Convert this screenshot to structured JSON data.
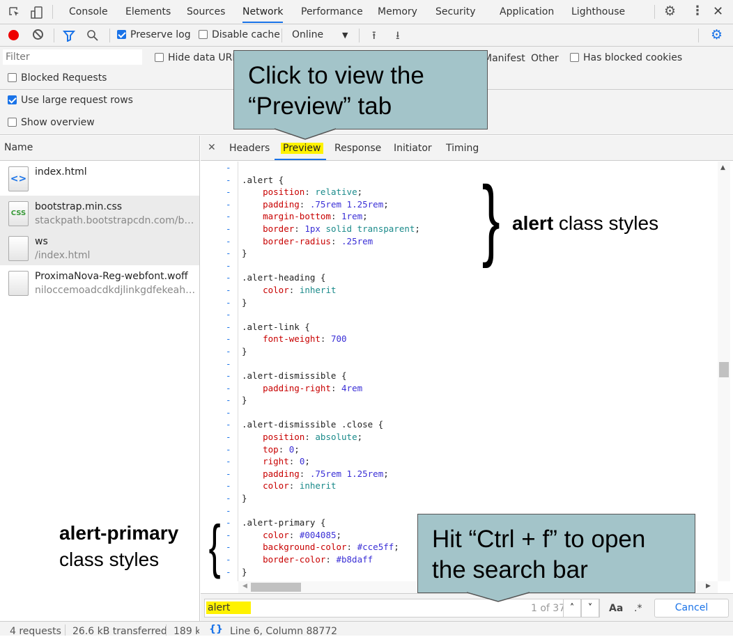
{
  "tabs": [
    "Console",
    "Elements",
    "Sources",
    "Network",
    "Performance",
    "Memory",
    "Security",
    "Application",
    "Lighthouse"
  ],
  "active_tab": "Network",
  "toolbar": {
    "preserve_log": "Preserve log",
    "disable_cache": "Disable cache",
    "throttle": "Online"
  },
  "filter": {
    "placeholder": "Filter",
    "hide_data_urls": "Hide data URLs",
    "manifest": "Manifest",
    "other": "Other",
    "has_blocked_cookies": "Has blocked cookies",
    "blocked_requests": "Blocked Requests"
  },
  "options": {
    "large_rows": "Use large request rows",
    "show_overview": "Show overview"
  },
  "list": {
    "header": "Name",
    "items": [
      {
        "name": "index.html",
        "sub": "",
        "icon": "html-file-icon"
      },
      {
        "name": "bootstrap.min.css",
        "sub": "stackpath.bootstrapcdn.com/boot...",
        "icon": "css-file-icon"
      },
      {
        "name": "ws",
        "sub": "/index.html",
        "icon": "file-icon"
      },
      {
        "name": "ProximaNova-Reg-webfont.woff",
        "sub": "niloccemoadcdkdjlinkgdfekeahmf...",
        "icon": "file-icon"
      }
    ]
  },
  "detail_tabs": [
    "Headers",
    "Preview",
    "Response",
    "Initiator",
    "Timing"
  ],
  "active_detail_tab": "Preview",
  "code": [
    {
      "t": ""
    },
    {
      "sel": ".alert {",
      "hl": "alert"
    },
    {
      "prop": "position",
      "val": "relative;"
    },
    {
      "prop": "padding",
      "val": ".75rem 1.25rem;"
    },
    {
      "prop": "margin-bottom",
      "val": "1rem;"
    },
    {
      "prop": "border",
      "val": "1px solid transparent;"
    },
    {
      "prop": "border-radius",
      "val": ".25rem"
    },
    {
      "t": "}"
    },
    {
      "t": ""
    },
    {
      "sel": ".alert-heading {"
    },
    {
      "prop": "color",
      "val": "inherit"
    },
    {
      "t": "}"
    },
    {
      "t": ""
    },
    {
      "sel": ".alert-link {"
    },
    {
      "prop": "font-weight",
      "val": "700"
    },
    {
      "t": "}"
    },
    {
      "t": ""
    },
    {
      "sel": ".alert-dismissible {"
    },
    {
      "prop": "padding-right",
      "val": "4rem"
    },
    {
      "t": "}"
    },
    {
      "t": ""
    },
    {
      "sel": ".alert-dismissible .close {"
    },
    {
      "prop": "position",
      "val": "absolute;"
    },
    {
      "prop": "top",
      "val": "0;"
    },
    {
      "prop": "right",
      "val": "0;"
    },
    {
      "prop": "padding",
      "val": ".75rem 1.25rem;"
    },
    {
      "prop": "color",
      "val": "inherit"
    },
    {
      "t": "}"
    },
    {
      "t": ""
    },
    {
      "sel": ".alert-primary {"
    },
    {
      "prop": "color",
      "val": "#004085;"
    },
    {
      "prop": "background-color",
      "val": "#cce5ff;"
    },
    {
      "prop": "border-color",
      "val": "#b8daff"
    },
    {
      "t": "}"
    }
  ],
  "search": {
    "value": "alert",
    "count": "1 of 37",
    "case": "Aa",
    "regex": ".*",
    "cancel": "Cancel"
  },
  "status": {
    "requests": "4 requests",
    "transferred": "26.6 kB transferred",
    "resources": "189 k",
    "position": "Line 6, Column 88772"
  },
  "annotations": {
    "callout_top": "Click to view the “Preview” tab",
    "callout_bottom": "Hit “Ctrl + f” to open the search bar",
    "right_bold": "alert",
    "right_rest": " class styles",
    "left_bold": "alert-primary",
    "left_rest": "class styles"
  },
  "colors": {
    "accent": "#1a73e8",
    "callout": "#a3c4c9",
    "highlight": "#fff200"
  }
}
